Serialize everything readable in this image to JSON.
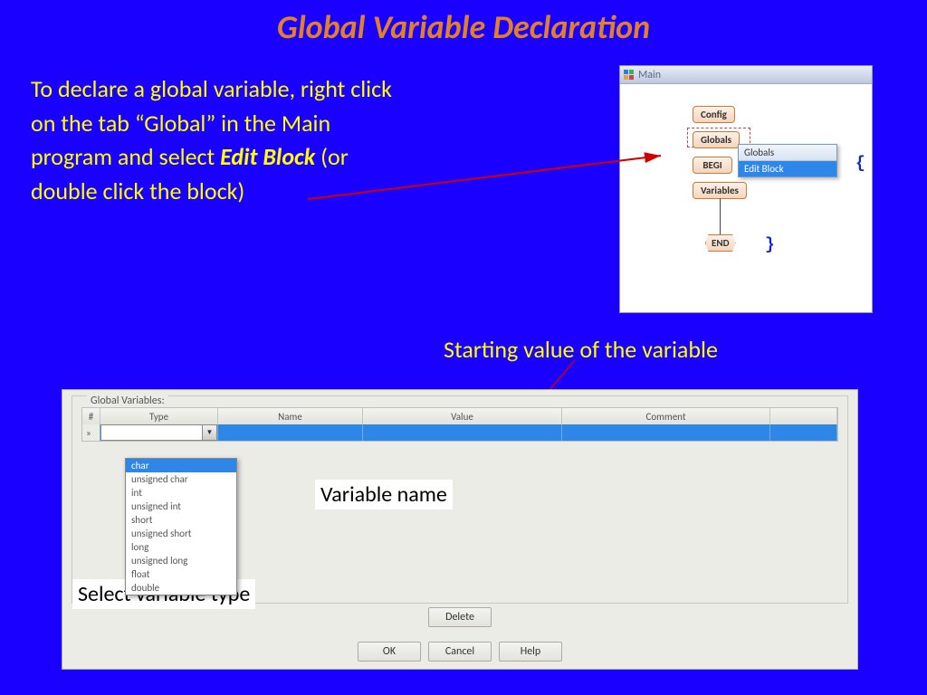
{
  "slide": {
    "title": "Global Variable Declaration",
    "body_1": "To declare a global variable, right click on the tab “Global” in the Main program and select ",
    "body_bold": "Edit Block",
    "body_2": "  (or double click the block)",
    "starting_value": "Starting value of the variable",
    "variable_name": "Variable name",
    "select_type": "Select variable type"
  },
  "main_window": {
    "title": "Main",
    "blocks": {
      "config": "Config",
      "globals": "Globals",
      "begi": "BEGI",
      "variables": "Variables",
      "end": "END"
    },
    "brace_open": "{",
    "brace_close": "}",
    "ctx_menu": {
      "header": "Globals",
      "item": "Edit Block"
    }
  },
  "gv_dialog": {
    "group_label": "Global Variables:",
    "columns": {
      "idx": "#",
      "type": "Type",
      "name": "Name",
      "value": "Value",
      "comment": "Comment"
    },
    "row_marker": "»",
    "type_options": [
      "char",
      "unsigned char",
      "int",
      "unsigned int",
      "short",
      "unsigned short",
      "long",
      "unsigned long",
      "float",
      "double"
    ],
    "buttons": {
      "delete": "Delete",
      "ok": "OK",
      "cancel": "Cancel",
      "help": "Help"
    }
  }
}
